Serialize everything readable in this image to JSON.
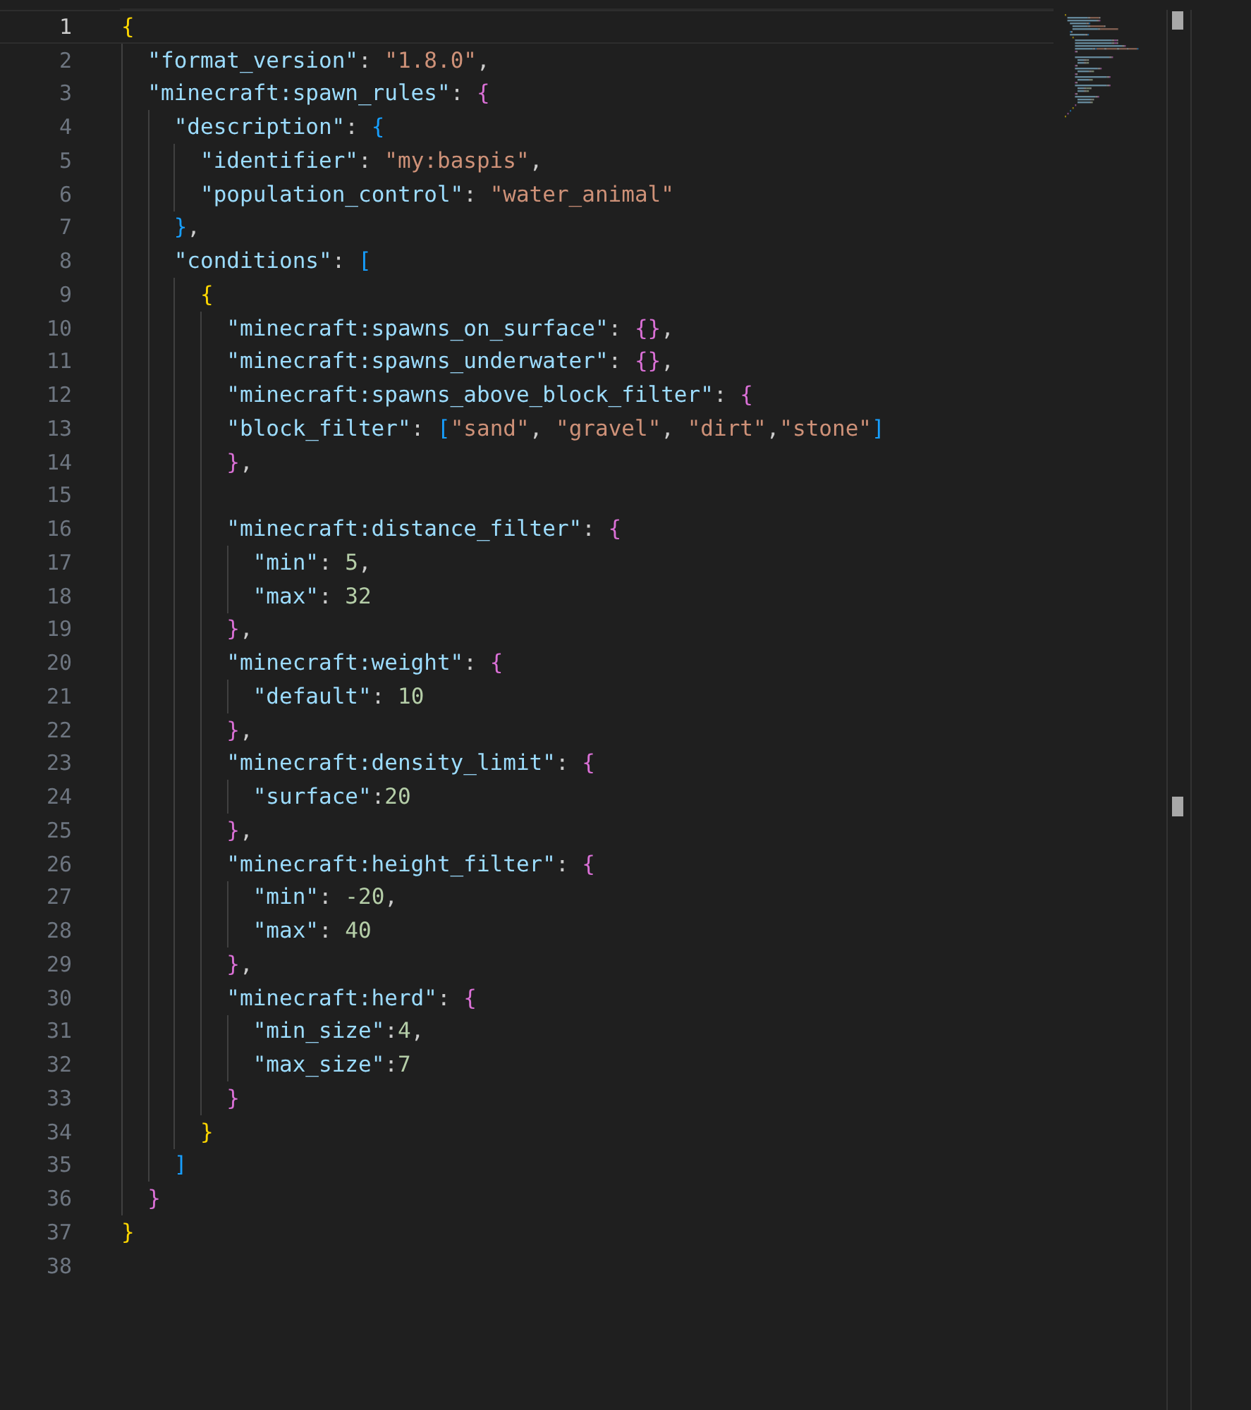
{
  "editor": {
    "lines": [
      {
        "number": "1",
        "current": true,
        "dedented": false,
        "tokens": [
          {
            "kind": "bracket",
            "text": "{"
          }
        ]
      },
      {
        "number": "2",
        "current": false,
        "dedented": false,
        "tokens": [
          {
            "kind": "key",
            "text": "\"format_version\""
          },
          {
            "kind": "punct",
            "text": ": "
          },
          {
            "kind": "string",
            "text": "\"1.8.0\""
          },
          {
            "kind": "punct",
            "text": ","
          }
        ]
      },
      {
        "number": "3",
        "current": false,
        "dedented": false,
        "tokens": [
          {
            "kind": "key",
            "text": "\"minecraft:spawn_rules\""
          },
          {
            "kind": "punct",
            "text": ": "
          },
          {
            "kind": "bracket",
            "text": "{"
          }
        ]
      },
      {
        "number": "4",
        "current": false,
        "dedented": false,
        "tokens": [
          {
            "kind": "key",
            "text": "\"description\""
          },
          {
            "kind": "punct",
            "text": ": "
          },
          {
            "kind": "bracket",
            "text": "{"
          }
        ]
      },
      {
        "number": "5",
        "current": false,
        "dedented": false,
        "tokens": [
          {
            "kind": "key",
            "text": "\"identifier\""
          },
          {
            "kind": "punct",
            "text": ": "
          },
          {
            "kind": "string",
            "text": "\"my:baspis\""
          },
          {
            "kind": "punct",
            "text": ","
          }
        ]
      },
      {
        "number": "6",
        "current": false,
        "dedented": false,
        "tokens": [
          {
            "kind": "key",
            "text": "\"population_control\""
          },
          {
            "kind": "punct",
            "text": ": "
          },
          {
            "kind": "string",
            "text": "\"water_animal\""
          }
        ]
      },
      {
        "number": "7",
        "current": false,
        "dedented": false,
        "tokens": [
          {
            "kind": "bracket",
            "text": "}"
          },
          {
            "kind": "punct",
            "text": ","
          }
        ]
      },
      {
        "number": "8",
        "current": false,
        "dedented": false,
        "tokens": [
          {
            "kind": "key",
            "text": "\"conditions\""
          },
          {
            "kind": "punct",
            "text": ": "
          },
          {
            "kind": "bracket",
            "text": "["
          }
        ]
      },
      {
        "number": "9",
        "current": false,
        "dedented": false,
        "tokens": [
          {
            "kind": "bracket",
            "text": "{"
          }
        ]
      },
      {
        "number": "10",
        "current": false,
        "dedented": false,
        "tokens": [
          {
            "kind": "key",
            "text": "\"minecraft:spawns_on_surface\""
          },
          {
            "kind": "punct",
            "text": ": "
          },
          {
            "kind": "bracket",
            "text": "{"
          },
          {
            "kind": "bracket",
            "text": "}"
          },
          {
            "kind": "punct",
            "text": ","
          }
        ]
      },
      {
        "number": "11",
        "current": false,
        "dedented": false,
        "tokens": [
          {
            "kind": "key",
            "text": "\"minecraft:spawns_underwater\""
          },
          {
            "kind": "punct",
            "text": ": "
          },
          {
            "kind": "bracket",
            "text": "{"
          },
          {
            "kind": "bracket",
            "text": "}"
          },
          {
            "kind": "punct",
            "text": ","
          }
        ]
      },
      {
        "number": "12",
        "current": false,
        "dedented": false,
        "tokens": [
          {
            "kind": "key",
            "text": "\"minecraft:spawns_above_block_filter\""
          },
          {
            "kind": "punct",
            "text": ": "
          },
          {
            "kind": "bracket",
            "text": "{"
          }
        ]
      },
      {
        "number": "13",
        "current": false,
        "dedented": true,
        "tokens": [
          {
            "kind": "key",
            "text": "\"block_filter\""
          },
          {
            "kind": "punct",
            "text": ": "
          },
          {
            "kind": "bracket",
            "text": "["
          },
          {
            "kind": "string",
            "text": "\"sand\""
          },
          {
            "kind": "punct",
            "text": ", "
          },
          {
            "kind": "string",
            "text": "\"gravel\""
          },
          {
            "kind": "punct",
            "text": ", "
          },
          {
            "kind": "string",
            "text": "\"dirt\""
          },
          {
            "kind": "punct",
            "text": ","
          },
          {
            "kind": "string",
            "text": "\"stone\""
          },
          {
            "kind": "bracket",
            "text": "]"
          }
        ]
      },
      {
        "number": "14",
        "current": false,
        "dedented": false,
        "tokens": [
          {
            "kind": "bracket",
            "text": "}"
          },
          {
            "kind": "punct",
            "text": ","
          }
        ]
      },
      {
        "number": "15",
        "current": false,
        "dedented": false
      },
      {
        "number": "16",
        "current": false,
        "dedented": false,
        "tokens": [
          {
            "kind": "key",
            "text": "\"minecraft:distance_filter\""
          },
          {
            "kind": "punct",
            "text": ": "
          },
          {
            "kind": "bracket",
            "text": "{"
          }
        ]
      },
      {
        "number": "17",
        "current": false,
        "dedented": false,
        "tokens": [
          {
            "kind": "key",
            "text": "\"min\""
          },
          {
            "kind": "punct",
            "text": ": "
          },
          {
            "kind": "number",
            "text": "5"
          },
          {
            "kind": "punct",
            "text": ","
          }
        ]
      },
      {
        "number": "18",
        "current": false,
        "dedented": false,
        "tokens": [
          {
            "kind": "key",
            "text": "\"max\""
          },
          {
            "kind": "punct",
            "text": ": "
          },
          {
            "kind": "number",
            "text": "32"
          }
        ]
      },
      {
        "number": "19",
        "current": false,
        "dedented": false,
        "tokens": [
          {
            "kind": "bracket",
            "text": "}"
          },
          {
            "kind": "punct",
            "text": ","
          }
        ]
      },
      {
        "number": "20",
        "current": false,
        "dedented": false,
        "tokens": [
          {
            "kind": "key",
            "text": "\"minecraft:weight\""
          },
          {
            "kind": "punct",
            "text": ": "
          },
          {
            "kind": "bracket",
            "text": "{"
          }
        ]
      },
      {
        "number": "21",
        "current": false,
        "dedented": false,
        "tokens": [
          {
            "kind": "key",
            "text": "\"default\""
          },
          {
            "kind": "punct",
            "text": ": "
          },
          {
            "kind": "number",
            "text": "10"
          }
        ]
      },
      {
        "number": "22",
        "current": false,
        "dedented": false,
        "tokens": [
          {
            "kind": "bracket",
            "text": "}"
          },
          {
            "kind": "punct",
            "text": ","
          }
        ]
      },
      {
        "number": "23",
        "current": false,
        "dedented": false,
        "tokens": [
          {
            "kind": "key",
            "text": "\"minecraft:density_limit\""
          },
          {
            "kind": "punct",
            "text": ": "
          },
          {
            "kind": "bracket",
            "text": "{"
          }
        ]
      },
      {
        "number": "24",
        "current": false,
        "dedented": false,
        "tokens": [
          {
            "kind": "key",
            "text": "\"surface\""
          },
          {
            "kind": "punct",
            "text": ":"
          },
          {
            "kind": "number",
            "text": "20"
          }
        ]
      },
      {
        "number": "25",
        "current": false,
        "dedented": false,
        "tokens": [
          {
            "kind": "bracket",
            "text": "}"
          },
          {
            "kind": "punct",
            "text": ","
          }
        ]
      },
      {
        "number": "26",
        "current": false,
        "dedented": false,
        "tokens": [
          {
            "kind": "key",
            "text": "\"minecraft:height_filter\""
          },
          {
            "kind": "punct",
            "text": ": "
          },
          {
            "kind": "bracket",
            "text": "{"
          }
        ]
      },
      {
        "number": "27",
        "current": false,
        "dedented": false,
        "tokens": [
          {
            "kind": "key",
            "text": "\"min\""
          },
          {
            "kind": "punct",
            "text": ": "
          },
          {
            "kind": "number",
            "text": "-20"
          },
          {
            "kind": "punct",
            "text": ","
          }
        ]
      },
      {
        "number": "28",
        "current": false,
        "dedented": false,
        "tokens": [
          {
            "kind": "key",
            "text": "\"max\""
          },
          {
            "kind": "punct",
            "text": ": "
          },
          {
            "kind": "number",
            "text": "40"
          }
        ]
      },
      {
        "number": "29",
        "current": false,
        "dedented": false,
        "tokens": [
          {
            "kind": "bracket",
            "text": "}"
          },
          {
            "kind": "punct",
            "text": ","
          }
        ]
      },
      {
        "number": "30",
        "current": false,
        "dedented": false,
        "tokens": [
          {
            "kind": "key",
            "text": "\"minecraft:herd\""
          },
          {
            "kind": "punct",
            "text": ": "
          },
          {
            "kind": "bracket",
            "text": "{"
          }
        ]
      },
      {
        "number": "31",
        "current": false,
        "dedented": false,
        "tokens": [
          {
            "kind": "key",
            "text": "\"min_size\""
          },
          {
            "kind": "punct",
            "text": ":"
          },
          {
            "kind": "number",
            "text": "4"
          },
          {
            "kind": "punct",
            "text": ","
          }
        ]
      },
      {
        "number": "32",
        "current": false,
        "dedented": false,
        "tokens": [
          {
            "kind": "key",
            "text": "\"max_size\""
          },
          {
            "kind": "punct",
            "text": ":"
          },
          {
            "kind": "number",
            "text": "7"
          }
        ]
      },
      {
        "number": "33",
        "current": false,
        "dedented": false,
        "tokens": [
          {
            "kind": "bracket",
            "text": "}"
          }
        ]
      },
      {
        "number": "34",
        "current": false,
        "dedented": false,
        "tokens": [
          {
            "kind": "bracket",
            "text": "}"
          }
        ]
      },
      {
        "number": "35",
        "current": false,
        "dedented": false,
        "tokens": [
          {
            "kind": "bracket",
            "text": "]"
          }
        ]
      },
      {
        "number": "36",
        "current": false,
        "dedented": false,
        "tokens": [
          {
            "kind": "bracket",
            "text": "}"
          }
        ]
      },
      {
        "number": "37",
        "current": false,
        "dedented": false,
        "tokens": [
          {
            "kind": "bracket",
            "text": "}"
          }
        ]
      },
      {
        "number": "38",
        "current": false
      }
    ]
  }
}
